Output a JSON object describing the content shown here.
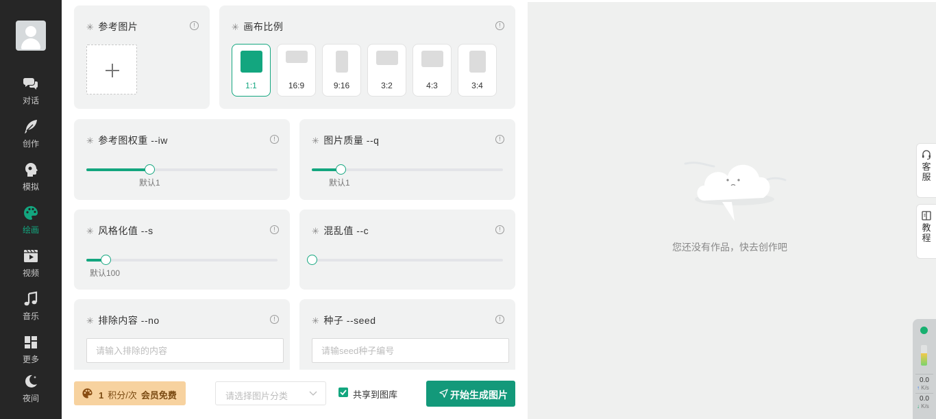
{
  "sidebar": {
    "items": [
      {
        "label": "对话",
        "icon": "chat-bubbles-icon"
      },
      {
        "label": "创作",
        "icon": "feather-icon"
      },
      {
        "label": "模拟",
        "icon": "head-profile-icon"
      },
      {
        "label": "绘画",
        "icon": "palette-icon",
        "active": true
      },
      {
        "label": "视频",
        "icon": "video-icon"
      },
      {
        "label": "音乐",
        "icon": "music-note-icon"
      },
      {
        "label": "更多",
        "icon": "grid-icon"
      },
      {
        "label": "夜间",
        "icon": "moon-icon"
      }
    ]
  },
  "reference_image": {
    "title": "参考图片",
    "info": "!"
  },
  "canvas_ratio": {
    "title": "画布比例",
    "info": "!",
    "options": [
      "1:1",
      "16:9",
      "9:16",
      "3:2",
      "4:3",
      "3:4"
    ],
    "selected": "1:1"
  },
  "sliders": {
    "iw": {
      "title": "参考图权重 --iw",
      "default_label": "默认1",
      "value_fraction": 0.33
    },
    "q": {
      "title": "图片质量 --q",
      "default_label": "默认1",
      "value_fraction": 0.15
    },
    "s": {
      "title": "风格化值 --s",
      "default_label": "默认100",
      "value_fraction": 0.1
    },
    "c": {
      "title": "混乱值 --c",
      "default_label": "",
      "value_fraction": 0
    }
  },
  "exclude": {
    "title": "排除内容 --no",
    "placeholder": "请输入排除的内容",
    "value": ""
  },
  "seed": {
    "title": "种子 --seed",
    "placeholder": "请输seed种子编号",
    "value": ""
  },
  "bottom": {
    "points_number": "1",
    "points_unit": "积分/次",
    "member_free": "会员免费",
    "category_placeholder": "请选择图片分类",
    "share_label": "共享到图库",
    "share_checked": true,
    "generate_label": "开始生成图片"
  },
  "right": {
    "empty_message": "您还没有作品，快去创作吧",
    "side_tabs": [
      {
        "label": "客服",
        "icon": "headset-icon"
      },
      {
        "label": "教程",
        "icon": "book-icon"
      }
    ]
  },
  "monitor": {
    "upload_speed": "0.0",
    "download_speed": "0.0",
    "unit": "K/s",
    "memory_fraction": 0.6
  },
  "colors": {
    "accent": "#13a67f",
    "sidebar_bg": "#262626",
    "points_bg": "#f7d29f"
  }
}
